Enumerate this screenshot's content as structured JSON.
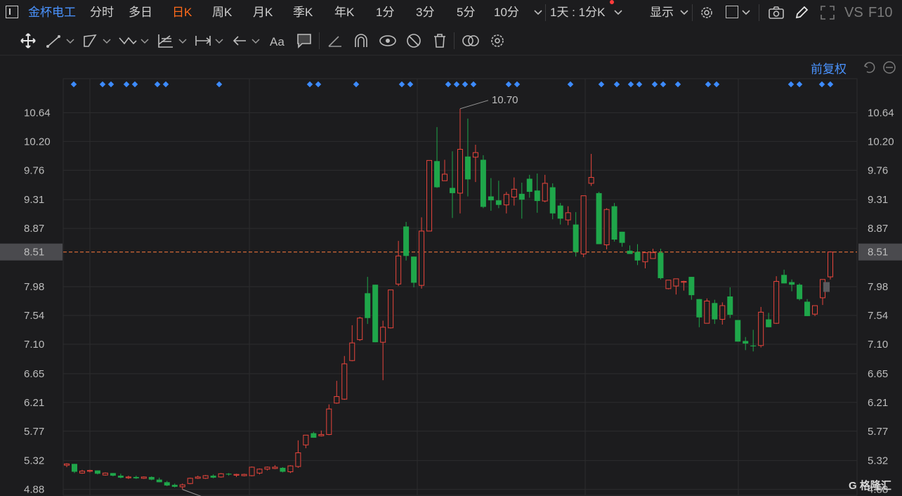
{
  "header": {
    "stock_name": "金杯电工",
    "periods": [
      "分时",
      "多日",
      "日K",
      "周K",
      "月K",
      "季K",
      "年K",
      "1分",
      "3分",
      "5分",
      "10分"
    ],
    "active_period": "日K",
    "multi_period": "1天 : 1分K",
    "display_label": "显示",
    "vs_label": "VS",
    "f10_label": "F10"
  },
  "toolbar": {
    "icons": [
      "move-icon",
      "line-icon",
      "channel-icon",
      "wave-icon",
      "fib-icon",
      "measure-icon",
      "arrow-icon",
      "text-icon",
      "note-icon",
      "eraser-icon",
      "magnet-icon",
      "eye-icon",
      "hide-icon",
      "trash-icon",
      "compare-icon",
      "settings-icon"
    ]
  },
  "chart_controls": {
    "adjust_label": "前复权"
  },
  "chart_data": {
    "type": "candlestick",
    "y_ticks": [
      "10.64",
      "10.20",
      "9.76",
      "9.31",
      "8.87",
      "8.51",
      "7.98",
      "7.54",
      "7.10",
      "6.65",
      "6.21",
      "5.77",
      "5.32",
      "4.88"
    ],
    "current_price": "8.51",
    "high_label": "10.70",
    "low_label": "4.88",
    "ylim": [
      4.79,
      11.16
    ],
    "colors": {
      "up": "#e8453c",
      "down": "#1fa64a",
      "grid": "#2c2c2e",
      "marker": "#3d8bff",
      "price_line": "#ff7a3c"
    },
    "candles": [
      [
        5.25,
        5.28,
        5.22,
        5.27
      ],
      [
        5.27,
        5.27,
        5.13,
        5.15
      ],
      [
        5.13,
        5.18,
        5.12,
        5.16
      ],
      [
        5.16,
        5.18,
        5.14,
        5.17
      ],
      [
        5.17,
        5.17,
        5.11,
        5.12
      ],
      [
        5.1,
        5.14,
        5.09,
        5.13
      ],
      [
        5.13,
        5.13,
        5.08,
        5.09
      ],
      [
        5.09,
        5.12,
        5.05,
        5.06
      ],
      [
        5.06,
        5.09,
        5.04,
        5.07
      ],
      [
        5.07,
        5.09,
        5.04,
        5.05
      ],
      [
        5.05,
        5.08,
        5.04,
        5.07
      ],
      [
        5.07,
        5.08,
        5.02,
        5.03
      ],
      [
        5.03,
        5.06,
        4.99,
        4.99
      ],
      [
        4.99,
        5.01,
        4.93,
        4.94
      ],
      [
        4.95,
        4.97,
        4.91,
        4.92
      ],
      [
        4.92,
        4.97,
        4.88,
        4.95
      ],
      [
        4.97,
        5.06,
        4.96,
        5.05
      ],
      [
        5.05,
        5.09,
        5.04,
        5.07
      ],
      [
        5.05,
        5.1,
        5.04,
        5.09
      ],
      [
        5.09,
        5.11,
        5.05,
        5.06
      ],
      [
        5.07,
        5.13,
        5.06,
        5.12
      ],
      [
        5.12,
        5.13,
        5.09,
        5.11
      ],
      [
        5.1,
        5.12,
        5.07,
        5.11
      ],
      [
        5.09,
        5.12,
        5.08,
        5.11
      ],
      [
        5.09,
        5.23,
        5.08,
        5.22
      ],
      [
        5.13,
        5.2,
        5.11,
        5.19
      ],
      [
        5.19,
        5.23,
        5.17,
        5.22
      ],
      [
        5.2,
        5.25,
        5.19,
        5.22
      ],
      [
        5.21,
        5.22,
        5.14,
        5.15
      ],
      [
        5.15,
        5.25,
        5.13,
        5.24
      ],
      [
        5.23,
        5.63,
        5.21,
        5.44
      ],
      [
        5.56,
        5.68,
        5.51,
        5.71
      ],
      [
        5.74,
        5.76,
        5.67,
        5.67
      ],
      [
        5.7,
        5.78,
        5.69,
        5.72
      ],
      [
        5.72,
        6.18,
        5.71,
        6.11
      ],
      [
        6.2,
        6.54,
        6.19,
        6.3
      ],
      [
        6.26,
        6.92,
        6.25,
        6.8
      ],
      [
        6.85,
        7.39,
        6.84,
        7.12
      ],
      [
        7.17,
        7.52,
        7.15,
        7.5
      ],
      [
        7.88,
        8.13,
        7.41,
        7.5
      ],
      [
        8.01,
        7.99,
        7.24,
        7.13
      ],
      [
        7.13,
        7.46,
        6.55,
        7.36
      ],
      [
        7.35,
        7.9,
        7.34,
        7.93
      ],
      [
        8.02,
        8.68,
        7.99,
        8.45
      ],
      [
        8.9,
        8.97,
        8.38,
        8.45
      ],
      [
        8.44,
        8.43,
        7.97,
        8.04
      ],
      [
        8.0,
        9.04,
        7.95,
        8.83
      ],
      [
        8.83,
        9.91,
        8.94,
        9.91
      ],
      [
        9.9,
        10.42,
        9.49,
        9.5
      ],
      [
        9.6,
        9.92,
        9.61,
        9.7
      ],
      [
        9.49,
        10.05,
        9.03,
        9.41
      ],
      [
        9.41,
        10.7,
        9.1,
        10.08
      ],
      [
        9.97,
        10.55,
        9.36,
        9.62
      ],
      [
        9.96,
        10.15,
        9.58,
        10.03
      ],
      [
        9.92,
        9.99,
        9.18,
        9.2
      ],
      [
        9.36,
        9.64,
        9.14,
        9.3
      ],
      [
        9.3,
        9.6,
        9.18,
        9.23
      ],
      [
        9.23,
        9.43,
        9.1,
        9.39
      ],
      [
        9.35,
        9.65,
        9.22,
        9.47
      ],
      [
        9.4,
        9.57,
        9.02,
        9.31
      ],
      [
        9.63,
        9.69,
        9.34,
        9.43
      ],
      [
        9.45,
        9.71,
        9.11,
        9.29
      ],
      [
        9.29,
        9.69,
        9.27,
        9.56
      ],
      [
        9.5,
        9.56,
        9.01,
        9.1
      ],
      [
        9.22,
        9.26,
        8.93,
        9.02
      ],
      [
        9.0,
        9.21,
        8.92,
        9.11
      ],
      [
        8.93,
        9.12,
        8.44,
        8.51
      ],
      [
        8.48,
        9.32,
        8.43,
        9.37
      ],
      [
        9.56,
        10.01,
        9.52,
        9.65
      ],
      [
        9.41,
        9.43,
        8.68,
        8.63
      ],
      [
        8.62,
        9.18,
        8.55,
        9.16
      ],
      [
        9.21,
        9.26,
        8.67,
        8.7
      ],
      [
        8.82,
        8.82,
        8.59,
        8.65
      ],
      [
        8.53,
        8.61,
        8.48,
        8.48
      ],
      [
        8.51,
        8.63,
        8.31,
        8.38
      ],
      [
        8.36,
        8.51,
        8.26,
        8.5
      ],
      [
        8.41,
        8.56,
        8.42,
        8.5
      ],
      [
        8.5,
        8.56,
        8.09,
        8.11
      ],
      [
        7.95,
        8.04,
        7.94,
        8.08
      ],
      [
        7.99,
        8.06,
        7.86,
        8.1
      ],
      [
        8.05,
        8.07,
        7.92,
        8.06
      ],
      [
        8.13,
        8.08,
        7.78,
        7.85
      ],
      [
        7.79,
        7.64,
        7.36,
        7.51
      ],
      [
        7.42,
        7.8,
        7.44,
        7.76
      ],
      [
        7.73,
        7.78,
        7.41,
        7.48
      ],
      [
        7.48,
        7.74,
        7.4,
        7.69
      ],
      [
        7.83,
        7.97,
        7.5,
        7.55
      ],
      [
        7.47,
        7.35,
        7.32,
        7.14
      ],
      [
        7.15,
        7.21,
        7.01,
        7.11
      ],
      [
        7.08,
        7.32,
        6.99,
        7.07
      ],
      [
        7.08,
        7.67,
        7.05,
        7.59
      ],
      [
        7.48,
        7.58,
        7.38,
        7.36
      ],
      [
        7.42,
        8.14,
        7.41,
        8.06
      ],
      [
        8.16,
        8.24,
        8.06,
        8.03
      ],
      [
        8.05,
        8.09,
        7.91,
        8.01
      ],
      [
        8.01,
        8.03,
        7.77,
        7.79
      ],
      [
        7.75,
        7.79,
        7.53,
        7.53
      ],
      [
        7.56,
        7.69,
        7.53,
        7.69
      ],
      [
        7.81,
        8.06,
        7.7,
        8.09
      ],
      [
        8.13,
        8.52,
        8.09,
        8.51
      ]
    ],
    "marker_x": [
      105,
      146,
      158,
      180,
      192,
      224,
      236,
      312,
      441,
      453,
      507,
      572,
      584,
      638,
      650,
      662,
      674,
      724,
      736,
      812,
      856,
      878,
      898,
      910,
      932,
      944,
      965,
      1008,
      1020,
      1126,
      1138,
      1170,
      1182
    ]
  }
}
